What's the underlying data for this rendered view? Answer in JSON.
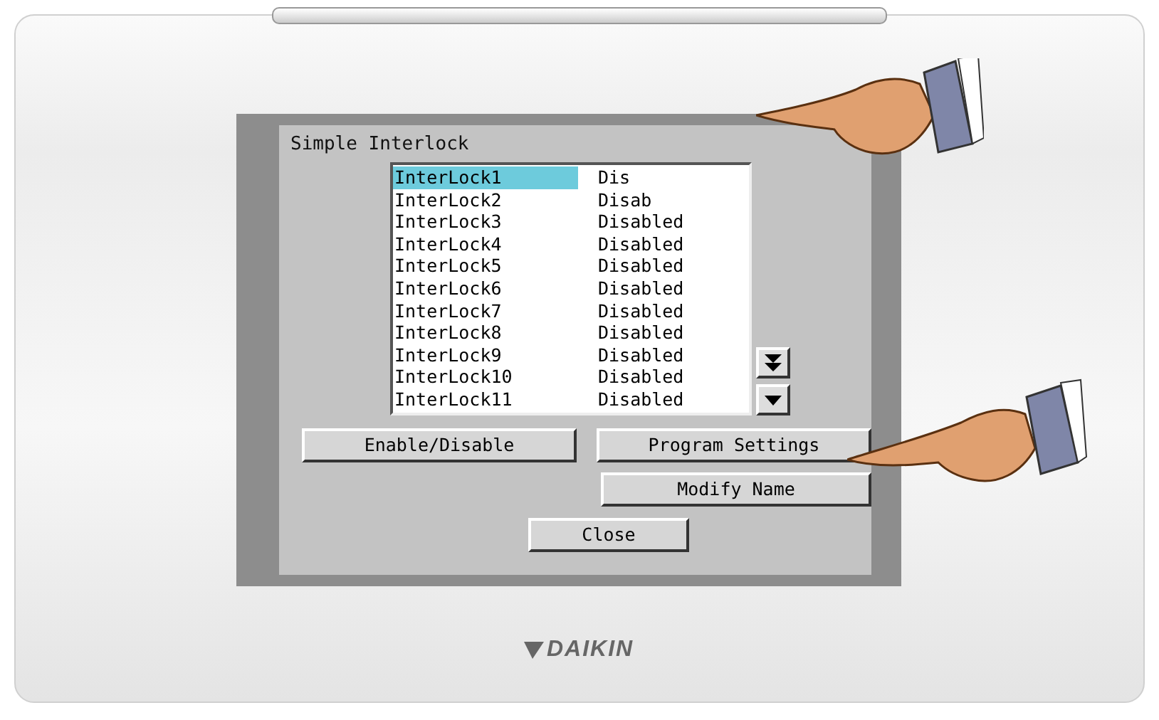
{
  "dialog": {
    "title": "Simple Interlock",
    "items": [
      {
        "name": "InterLock1",
        "status": "Dis",
        "selected": true
      },
      {
        "name": "InterLock2",
        "status": "Disab",
        "selected": false
      },
      {
        "name": "InterLock3",
        "status": "Disabled",
        "selected": false
      },
      {
        "name": "InterLock4",
        "status": "Disabled",
        "selected": false
      },
      {
        "name": "InterLock5",
        "status": "Disabled",
        "selected": false
      },
      {
        "name": "InterLock6",
        "status": "Disabled",
        "selected": false
      },
      {
        "name": "InterLock7",
        "status": "Disabled",
        "selected": false
      },
      {
        "name": "InterLock8",
        "status": "Disabled",
        "selected": false
      },
      {
        "name": "InterLock9",
        "status": "Disabled",
        "selected": false
      },
      {
        "name": "InterLock10",
        "status": "Disabled",
        "selected": false
      },
      {
        "name": "InterLock11",
        "status": "Disabled",
        "selected": false
      }
    ],
    "buttons": {
      "enable_disable": "Enable/Disable",
      "program_settings": "Program Settings",
      "modify_name": "Modify Name",
      "close": "Close"
    }
  },
  "brand": "DAIKIN"
}
